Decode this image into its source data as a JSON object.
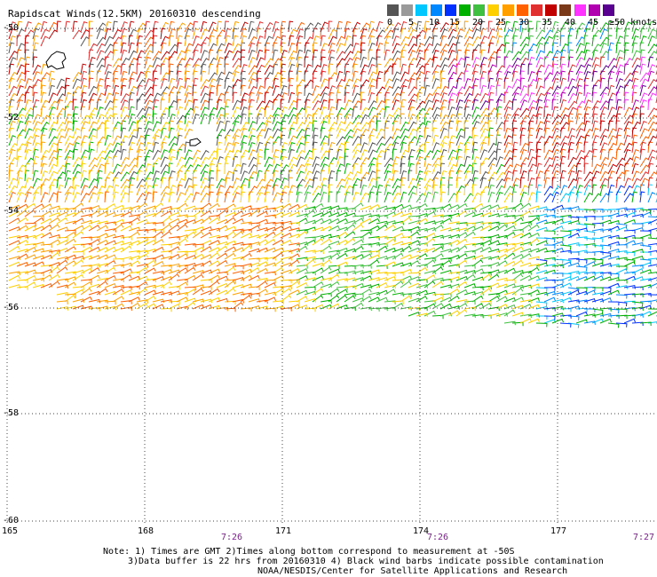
{
  "title": "Rapidscat Winds(12.5KM) 20160310 descending",
  "legend": {
    "colors": [
      "#555555",
      "#9a9a9a",
      "#00c8ff",
      "#0088ff",
      "#0030ff",
      "#00b000",
      "#40c040",
      "#ffd000",
      "#ffa000",
      "#ff6000",
      "#e03030",
      "#c00000",
      "#7a3a1a",
      "#ff33ff",
      "#b000b0",
      "#5a0090"
    ],
    "labels": [
      "0",
      "5",
      "10",
      "15",
      "20",
      "25",
      "30",
      "35",
      "40",
      "45",
      "≥50 knots"
    ]
  },
  "map": {
    "lat_labels": [
      "-50",
      "-52",
      "-54",
      "-56",
      "-58",
      "-60"
    ],
    "lon_labels": [
      "165",
      "168",
      "171",
      "174",
      "177"
    ],
    "time_labels": [
      "7:26",
      "7:26",
      "7:27"
    ],
    "grid": true
  },
  "notes": {
    "line1": "Note: 1) Times are GMT 2)Times along bottom correspond to measurement at -50S",
    "line2": "3)Data buffer is 22 hrs from 20160310 4) Black wind barbs indicate possible contamination",
    "line3": "NOAA/NESDIS/Center for Satellite Applications and Research"
  }
}
